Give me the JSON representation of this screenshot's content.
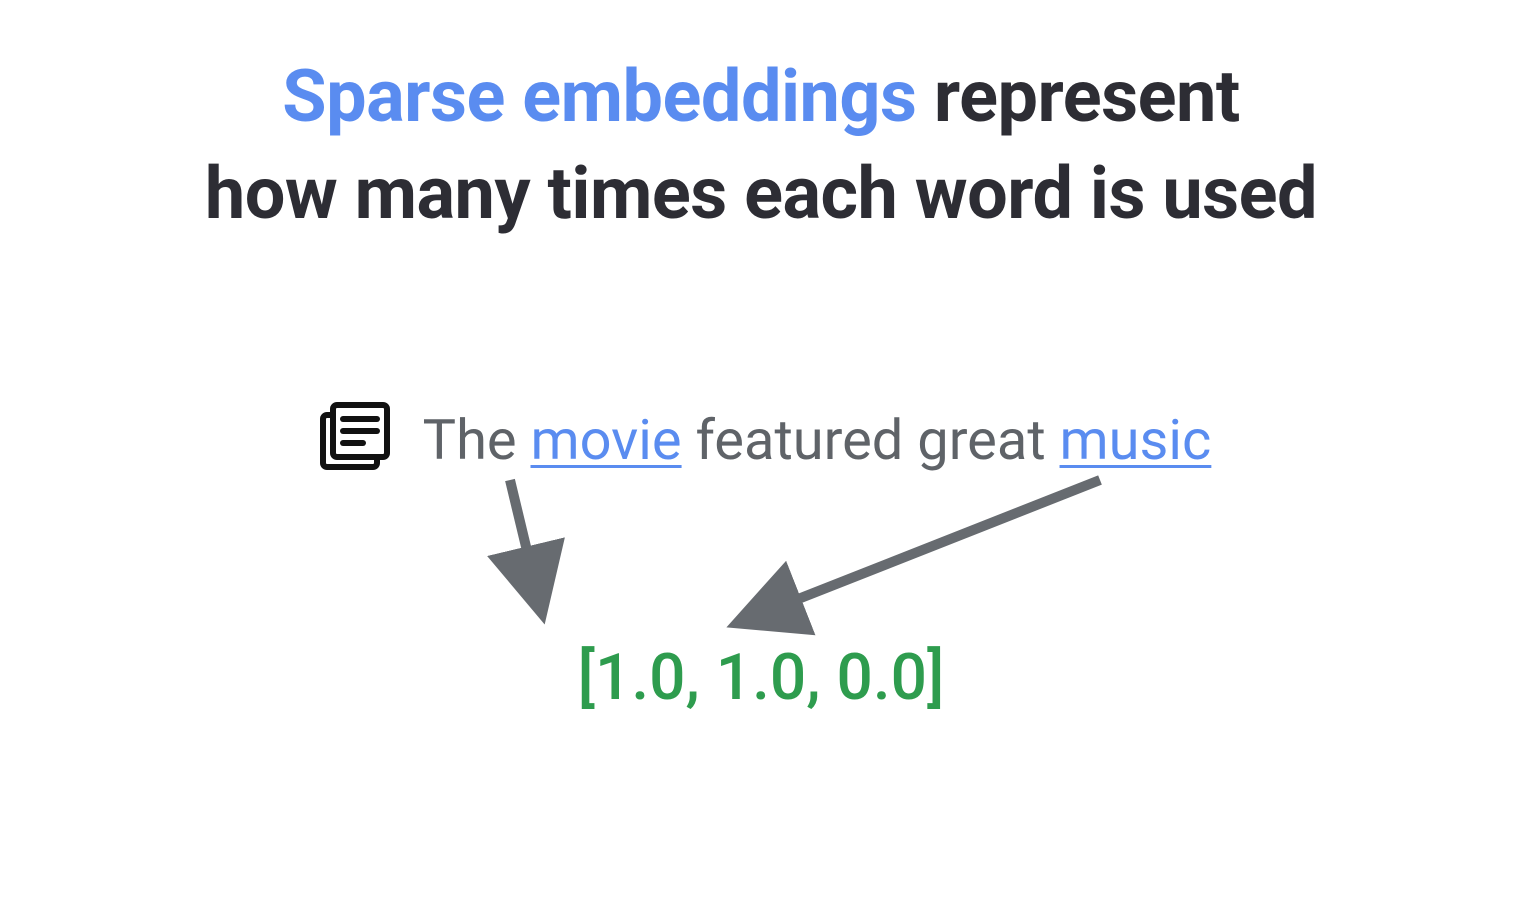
{
  "headline": {
    "emphasis": "Sparse embeddings",
    "rest1": " represent",
    "line2": "how many times each word is used"
  },
  "sentence": {
    "w1": "The ",
    "kw1": "movie",
    "w2": " featured great ",
    "kw2": "music"
  },
  "vector_text": "[1.0, 1.0, 0.0]",
  "colors": {
    "accent_blue": "#5a8cf0",
    "body_gray": "#5f6368",
    "vector_green": "#2e9c4e",
    "arrow_gray": "#676b70"
  },
  "icons": {
    "document": "document-stack-icon"
  }
}
